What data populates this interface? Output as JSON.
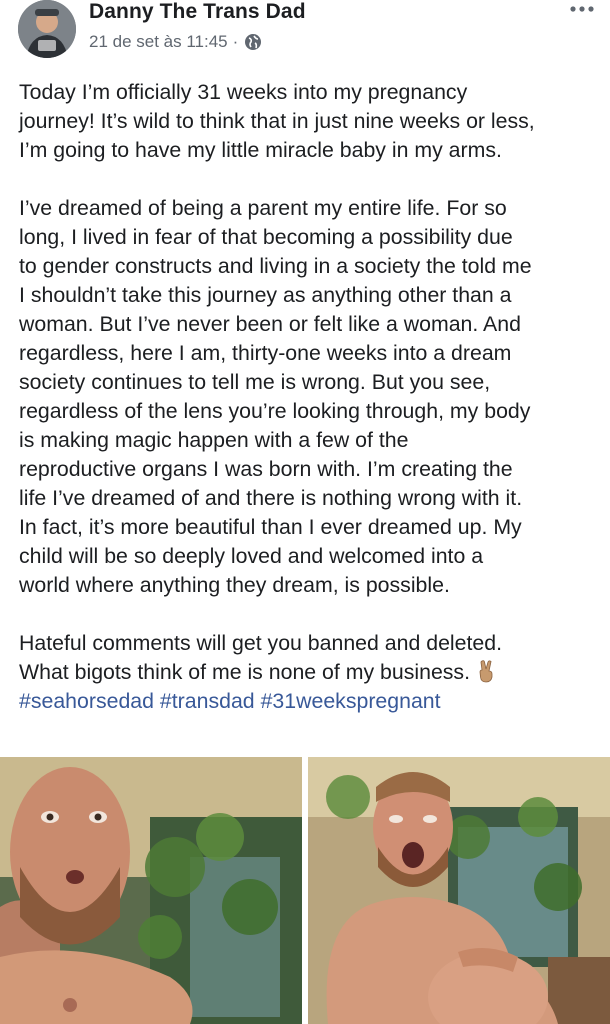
{
  "post": {
    "author": "Danny The Trans Dad",
    "timestamp": "21 de set às 11:45",
    "separator": "·",
    "privacy_icon": "globe-icon",
    "more_icon": "more-horizontal-icon",
    "paragraphs": [
      [
        "Today I’m officially 31 weeks into my pregnancy",
        "journey! It’s wild to think that in just nine weeks or less,",
        "I’m going to have my little miracle baby in my arms."
      ],
      [
        "I’ve dreamed of being a parent my entire life. For so",
        "long, I lived in fear of that becoming a possibility due",
        "to gender constructs and living in a society the told me",
        "I shouldn’t take this journey as anything other than a",
        "woman. But I’ve never been or felt like a woman. And",
        "regardless, here I am, thirty-one weeks into a dream",
        "society continues to tell me is wrong. But you see,",
        "regardless of the lens you’re looking through, my body",
        "is making magic happen with a few of the",
        "reproductive organs I was born with. I’m creating the",
        "life I’ve dreamed of and there is nothing wrong with it.",
        "In fact, it’s more beautiful than I ever dreamed up. My",
        "child will be so deeply loved and welcomed into a",
        "world where anything they dream, is possible."
      ],
      [
        "Hateful comments will get you banned and deleted.",
        "What bigots think of me is none of my business."
      ]
    ],
    "emoji": "victory-hand-emoji",
    "hashtags": [
      "#seahorsedad",
      "#transdad",
      "#31weekspregnant"
    ],
    "colors": {
      "text": "#1c1e21",
      "meta": "#606770",
      "link": "#385898"
    },
    "photos": [
      {
        "name": "photo-left",
        "description_icon": "photo-icon"
      },
      {
        "name": "photo-right",
        "description_icon": "photo-icon"
      }
    ]
  }
}
